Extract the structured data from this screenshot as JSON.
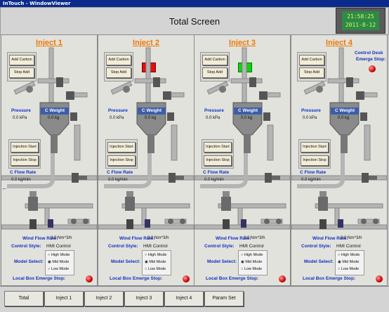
{
  "window": {
    "title": "InTouch - WindowViewer"
  },
  "header": {
    "title": "Total Screen",
    "time": "21:58:25",
    "date": "2011-8-12"
  },
  "panels": [
    {
      "title": "Inject 1",
      "add_carbon": "Add Carbon",
      "stop_add": "Stop Add",
      "pressure_label": "Pressure",
      "pressure_value": "0.0 kPa",
      "cweight_label": "C Weight",
      "cweight_value": "0.0 kg",
      "inj_start": "Injection Start",
      "inj_stop": "Injection Stop",
      "cflow_label": "C Flow Rate",
      "cflow_value": "0.0 kg/min",
      "wind_label": "Wind Flow Rate:",
      "wind_value": "0.0 Nm^3/h",
      "control_label": "Control Style:",
      "control_value": "HMI Control",
      "model_label": "Model Select:",
      "modes": [
        "High Mode",
        "Mid Mode",
        "Low Mode"
      ],
      "emerge_label": "Local Box Emerge Stop:",
      "valve_state": "none"
    },
    {
      "title": "Inject 2",
      "add_carbon": "Add Carbon",
      "stop_add": "Stop Add",
      "pressure_label": "Pressure",
      "pressure_value": "0.0 kPa",
      "cweight_label": "C Weight",
      "cweight_value": "0.0 kg",
      "inj_start": "Injection Start",
      "inj_stop": "Injection Stop",
      "cflow_label": "C Flow Rate",
      "cflow_value": "0.0 kg/min",
      "wind_label": "Wind Flow Rate:",
      "wind_value": "0.0 Nm^3/h",
      "control_label": "Control Style:",
      "control_value": "HMI Control",
      "model_label": "Model Select:",
      "modes": [
        "High Mode",
        "Mid Mode",
        "Low Mode"
      ],
      "emerge_label": "Local Box Emerge Stop:",
      "valve_state": "red"
    },
    {
      "title": "Inject 3",
      "add_carbon": "Add Carbon",
      "stop_add": "Stop Add",
      "pressure_label": "Pressure",
      "pressure_value": "0.0 kPa",
      "cweight_label": "C Weight",
      "cweight_value": "0.0 kg",
      "inj_start": "Injection Start",
      "inj_stop": "Injection Stop",
      "cflow_label": "C Flow Rate",
      "cflow_value": "0.0 kg/min",
      "wind_label": "Wind Flow Rate:",
      "wind_value": "0.0 Nm^3/h",
      "control_label": "Control Style:",
      "control_value": "HMI Control",
      "model_label": "Model Select:",
      "modes": [
        "High Mode",
        "Mid Mode",
        "Low Mode"
      ],
      "emerge_label": "Local Box Emerge Stop:",
      "valve_state": "green"
    },
    {
      "title": "Inject 4",
      "add_carbon": "Add Carbon",
      "stop_add": "Stop Add",
      "pressure_label": "Pressure",
      "pressure_value": "0.0 kPa",
      "cweight_label": "C Weight",
      "cweight_value": "0.0 kg",
      "inj_start": "Injection Start",
      "inj_stop": "Injection Stop",
      "cflow_label": "C Flow Rate",
      "cflow_value": "0.0 kg/min",
      "wind_label": "Wind Flow Rate:",
      "wind_value": "0.0 Nm^3/h",
      "control_label": "Control Style:",
      "control_value": "HMI Control",
      "model_label": "Model Select:",
      "modes": [
        "High Mode",
        "Mid Mode",
        "Low Mode"
      ],
      "emerge_label": "Local Box Emerge Stop:",
      "valve_state": "none",
      "desk_emerge_label_1": "Control Desk",
      "desk_emerge_label_2": "Emerge Stop:"
    }
  ],
  "nav": [
    "Total",
    "Inject 1",
    "Inject 2",
    "Inject 3",
    "Inject 4",
    "Param Set"
  ],
  "colors": {
    "title_orange": "#f07800",
    "label_blue": "#1030c0",
    "lamp_red": "#d00000",
    "valve_red": "#e01010",
    "valve_green": "#10d010"
  }
}
